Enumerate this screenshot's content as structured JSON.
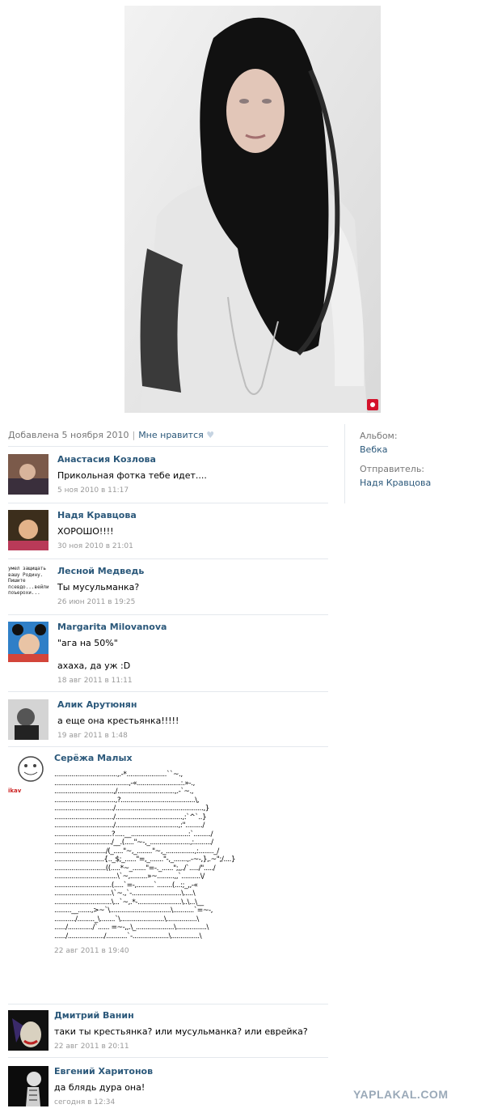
{
  "photo": {
    "alt": "photo"
  },
  "meta": {
    "added": "Добавлена 5 ноября 2010",
    "like": "Мне нравится",
    "heart": "♥"
  },
  "sidebar": {
    "album_label": "Альбом:",
    "album_value": "Вебка",
    "sender_label": "Отправитель:",
    "sender_value": "Надя Кравцова"
  },
  "comments": [
    {
      "author": "Анастасия Козлова",
      "text": "Прикольная фотка тебе идет....",
      "time": "5 ноя 2010 в 11:17"
    },
    {
      "author": "Надя Кравцова",
      "text": "ХОРОШО!!!!",
      "time": "30 ноя 2010 в 21:01"
    },
    {
      "author": "Лесной Медведь",
      "text": "Ты мусульманка?",
      "time": "26 июн 2011 в 19:25"
    },
    {
      "author": "Margarita Milovanova",
      "text": "\"ага на 50%\"\n\nахаха, да уж :D",
      "time": "18 авг 2011 в 11:11"
    },
    {
      "author": "Алик Арутюнян",
      "text": "а еще она крестьянка!!!!!",
      "time": "19 авг 2011 в 1:48"
    },
    {
      "author": "Серёжа Малых",
      "ascii": ".................................,.-*.....................``~.,\n.......................................,-«.......................:.»-.,\n...............................,/..............................,.-`~.,\n................................,?.......................................\\,\n.............................../..............................................,}\n.............................../...................................,:`^`..}\n.............................../.................................,:\"........./\n..............................?.....__..............................:`........./\n............................../__.(.....\"~-,_.....................,:........./\n.........................../(_.....\"~,_........\"~,_...............,:........_/\n..........................{.._$;_......\"=,_.......\"-,_.......,.-~-,},.~\";/....}\n...........................((.....*~_.......\"=-._......\";,,./`...../\"...../\n.................................\\`~,.........»~.........,,`..........\\/\n..............................(.....`=-,.........`........(...:;_,,-«\n..............................\\`~.,`-..........................\\.....\\\n..............................\\...`~,.*-.......................\\..\\...\\__\n.........__.......,>~`\\................................\\...........`=~-,\n.........../........._\\........`\\.......................\\................\\\n....../............./`...... =~-,,.\\_....................\\................\\\n....../.................../...........`-...................\\...............\\",
      "time": "22 авг 2011 в 19:40"
    },
    {
      "author": "Дмитрий Ванин",
      "text": "таки ты крестьянка? или мусульманка? или еврейка?",
      "time": "22 авг 2011 в 20:11"
    },
    {
      "author": "Евгений Харитонов",
      "text": "да блядь дура она!",
      "time": "сегодня в 12:34"
    }
  ],
  "avatar3_text": "умел защищать\nвашу Родину.\nПишите\nпсевдо...вейли\nпоъерохи...",
  "avatar6_text": "ikav",
  "watermark": "YAPLAKAL.COM",
  "colors": {
    "link": "#2b587a",
    "muted": "#777777",
    "divider": "#e4e8ed"
  }
}
